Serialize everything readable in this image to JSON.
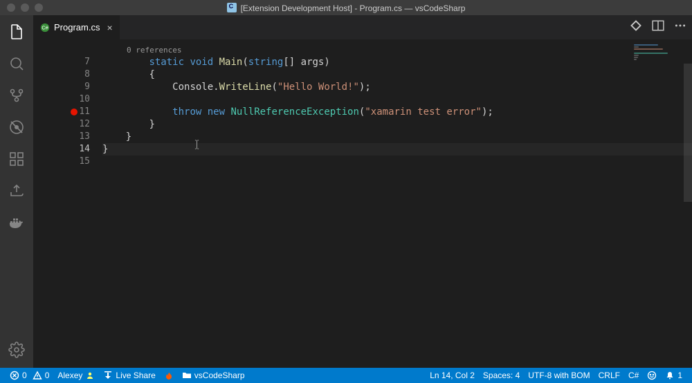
{
  "title": "[Extension Development Host] - Program.cs — vsCodeSharp",
  "tab": {
    "name": "Program.cs",
    "icon": "csharp-file"
  },
  "codelens": "0 references",
  "code": {
    "lines": [
      {
        "n": 7,
        "indent": 2,
        "tokens": [
          [
            "k1",
            "static"
          ],
          [
            "p",
            " "
          ],
          [
            "k1",
            "void"
          ],
          [
            "p",
            " "
          ],
          [
            "fn",
            "Main"
          ],
          [
            "p",
            "("
          ],
          [
            "k1",
            "string"
          ],
          [
            "p",
            "[] "
          ],
          [
            "p",
            "args"
          ],
          [
            "p",
            ")"
          ]
        ]
      },
      {
        "n": 8,
        "indent": 2,
        "tokens": [
          [
            "p",
            "{"
          ]
        ]
      },
      {
        "n": 9,
        "indent": 3,
        "tokens": [
          [
            "p",
            "Console."
          ],
          [
            "fn",
            "WriteLine"
          ],
          [
            "p",
            "("
          ],
          [
            "s",
            "\"Hello World!\""
          ],
          [
            "p",
            ");"
          ]
        ]
      },
      {
        "n": 10,
        "indent": 0,
        "tokens": []
      },
      {
        "n": 11,
        "indent": 3,
        "tokens": [
          [
            "k1",
            "throw"
          ],
          [
            "p",
            " "
          ],
          [
            "k1",
            "new"
          ],
          [
            "p",
            " "
          ],
          [
            "k2",
            "NullReferenceException"
          ],
          [
            "p",
            "("
          ],
          [
            "s",
            "\"xamarin test error\""
          ],
          [
            "p",
            ");"
          ]
        ],
        "breakpoint": true
      },
      {
        "n": 12,
        "indent": 2,
        "tokens": [
          [
            "p",
            "}"
          ]
        ]
      },
      {
        "n": 13,
        "indent": 1,
        "tokens": [
          [
            "p",
            "}"
          ]
        ]
      },
      {
        "n": 14,
        "indent": 0,
        "tokens": [
          [
            "p",
            "}"
          ]
        ],
        "current": true
      },
      {
        "n": 15,
        "indent": 0,
        "tokens": []
      }
    ]
  },
  "status": {
    "errors": "0",
    "warnings": "0",
    "user": "Alexey",
    "liveshare": "Live Share",
    "folder": "vsCodeSharp",
    "pos": "Ln 14, Col 2",
    "spaces": "Spaces: 4",
    "encoding": "UTF-8 with BOM",
    "eol": "CRLF",
    "lang": "C#",
    "bell": "1"
  }
}
